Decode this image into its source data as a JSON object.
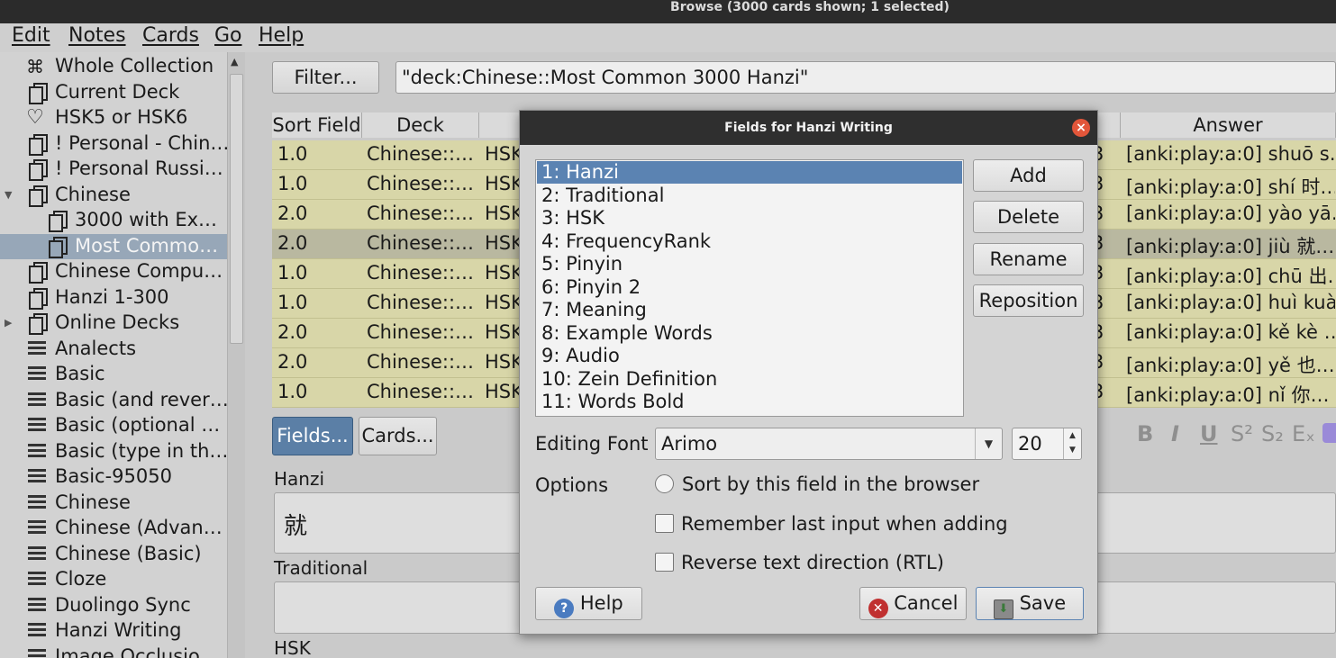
{
  "window": {
    "title": "Browse (3000 cards shown; 1 selected)"
  },
  "menu": [
    "Edit",
    "Notes",
    "Cards",
    "Go",
    "Help"
  ],
  "sidebar": {
    "items": [
      {
        "label": "Whole Collection",
        "icon": "collection-icon"
      },
      {
        "label": "Current Deck",
        "icon": "deck-icon"
      },
      {
        "label": "HSK5 or HSK6",
        "icon": "heart-icon"
      },
      {
        "label": "! Personal - Chin…",
        "icon": "deck-icon"
      },
      {
        "label": "! Personal Russi…",
        "icon": "deck-icon"
      },
      {
        "label": "Chinese",
        "icon": "deck-icon"
      },
      {
        "label": "3000 with Ex…",
        "icon": "deck-icon"
      },
      {
        "label": "Most Commo…",
        "icon": "deck-icon",
        "selected": true
      },
      {
        "label": "Chinese Compu…",
        "icon": "deck-icon"
      },
      {
        "label": "Hanzi 1-300",
        "icon": "deck-icon"
      },
      {
        "label": "Online Decks",
        "icon": "deck-icon"
      },
      {
        "label": "Analects",
        "icon": "note-type-icon"
      },
      {
        "label": "Basic",
        "icon": "note-type-icon"
      },
      {
        "label": "Basic (and rever…",
        "icon": "note-type-icon"
      },
      {
        "label": "Basic (optional …",
        "icon": "note-type-icon"
      },
      {
        "label": "Basic (type in th…",
        "icon": "note-type-icon"
      },
      {
        "label": "Basic-95050",
        "icon": "note-type-icon"
      },
      {
        "label": "Chinese",
        "icon": "note-type-icon"
      },
      {
        "label": "Chinese (Advan…",
        "icon": "note-type-icon"
      },
      {
        "label": "Chinese (Basic)",
        "icon": "note-type-icon"
      },
      {
        "label": "Cloze",
        "icon": "note-type-icon"
      },
      {
        "label": "Duolingo Sync",
        "icon": "note-type-icon"
      },
      {
        "label": "Hanzi Writing",
        "icon": "note-type-icon"
      },
      {
        "label": "Image Occlusio…",
        "icon": "note-type-icon"
      }
    ]
  },
  "toolbar": {
    "filter_label": "Filter...",
    "search_value": "\"deck:Chinese::Most Common 3000 Hanzi\""
  },
  "table": {
    "columns": [
      "Sort Field",
      "Deck",
      "",
      "Answer"
    ],
    "rows": [
      {
        "sort": "1.0",
        "deck": "Chinese::…",
        "q": "HSK",
        "qtail": "3",
        "answer": "[anki:play:a:0] shuō  s…"
      },
      {
        "sort": "1.0",
        "deck": "Chinese::…",
        "q": "HSK",
        "qtail": "3",
        "answer": "[anki:play:a:0] shí    时…"
      },
      {
        "sort": "2.0",
        "deck": "Chinese::…",
        "q": "HSK",
        "qtail": "3",
        "answer": "[anki:play:a:0] yào  yā…"
      },
      {
        "sort": "2.0",
        "deck": "Chinese::…",
        "q": "HSK",
        "qtail": "3",
        "answer": "[anki:play:a:0] jiù    就…"
      },
      {
        "sort": "1.0",
        "deck": "Chinese::…",
        "q": "HSK",
        "qtail": "3",
        "answer": "[anki:play:a:0] chū    出…"
      },
      {
        "sort": "1.0",
        "deck": "Chinese::…",
        "q": "HSK",
        "qtail": "3",
        "answer": "[anki:play:a:0] huì  kuà…"
      },
      {
        "sort": "2.0",
        "deck": "Chinese::…",
        "q": "HSK",
        "qtail": "3",
        "answer": "[anki:play:a:0] kě  kè …"
      },
      {
        "sort": "2.0",
        "deck": "Chinese::…",
        "q": "HSK",
        "qtail": "3",
        "answer": "[anki:play:a:0] yě    也…"
      },
      {
        "sort": "1.0",
        "deck": "Chinese::…",
        "q": "HSK",
        "qtail": "3",
        "answer": "[anki:play:a:0] nǐ    你…"
      }
    ]
  },
  "editor": {
    "fields_button": "Fields...",
    "cards_button": "Cards...",
    "format_icons": [
      "B",
      "I",
      "U",
      "S²",
      "S₂",
      "Eₓ"
    ],
    "fields": [
      {
        "label": "Hanzi",
        "value": "就"
      },
      {
        "label": "Traditional",
        "value": ""
      },
      {
        "label": "HSK",
        "value": ""
      }
    ]
  },
  "dialog": {
    "title": "Fields for Hanzi Writing",
    "fields": [
      "1: Hanzi",
      "2: Traditional",
      "3: HSK",
      "4: FrequencyRank",
      "5: Pinyin",
      "6: Pinyin 2",
      "7: Meaning",
      "8: Example Words",
      "9: Audio",
      "10: Zein Definition",
      "11: Words Bold"
    ],
    "selected_field_index": 0,
    "buttons": {
      "add": "Add",
      "delete": "Delete",
      "rename": "Rename",
      "reposition": "Reposition"
    },
    "editing_font_label": "Editing Font",
    "editing_font_value": "Arimo",
    "font_size": "20",
    "options_label": "Options",
    "options": {
      "sort": "Sort by this field in the browser",
      "remember": "Remember last input when adding",
      "rtl": "Reverse text direction (RTL)"
    },
    "help": "Help",
    "cancel": "Cancel",
    "save": "Save"
  }
}
